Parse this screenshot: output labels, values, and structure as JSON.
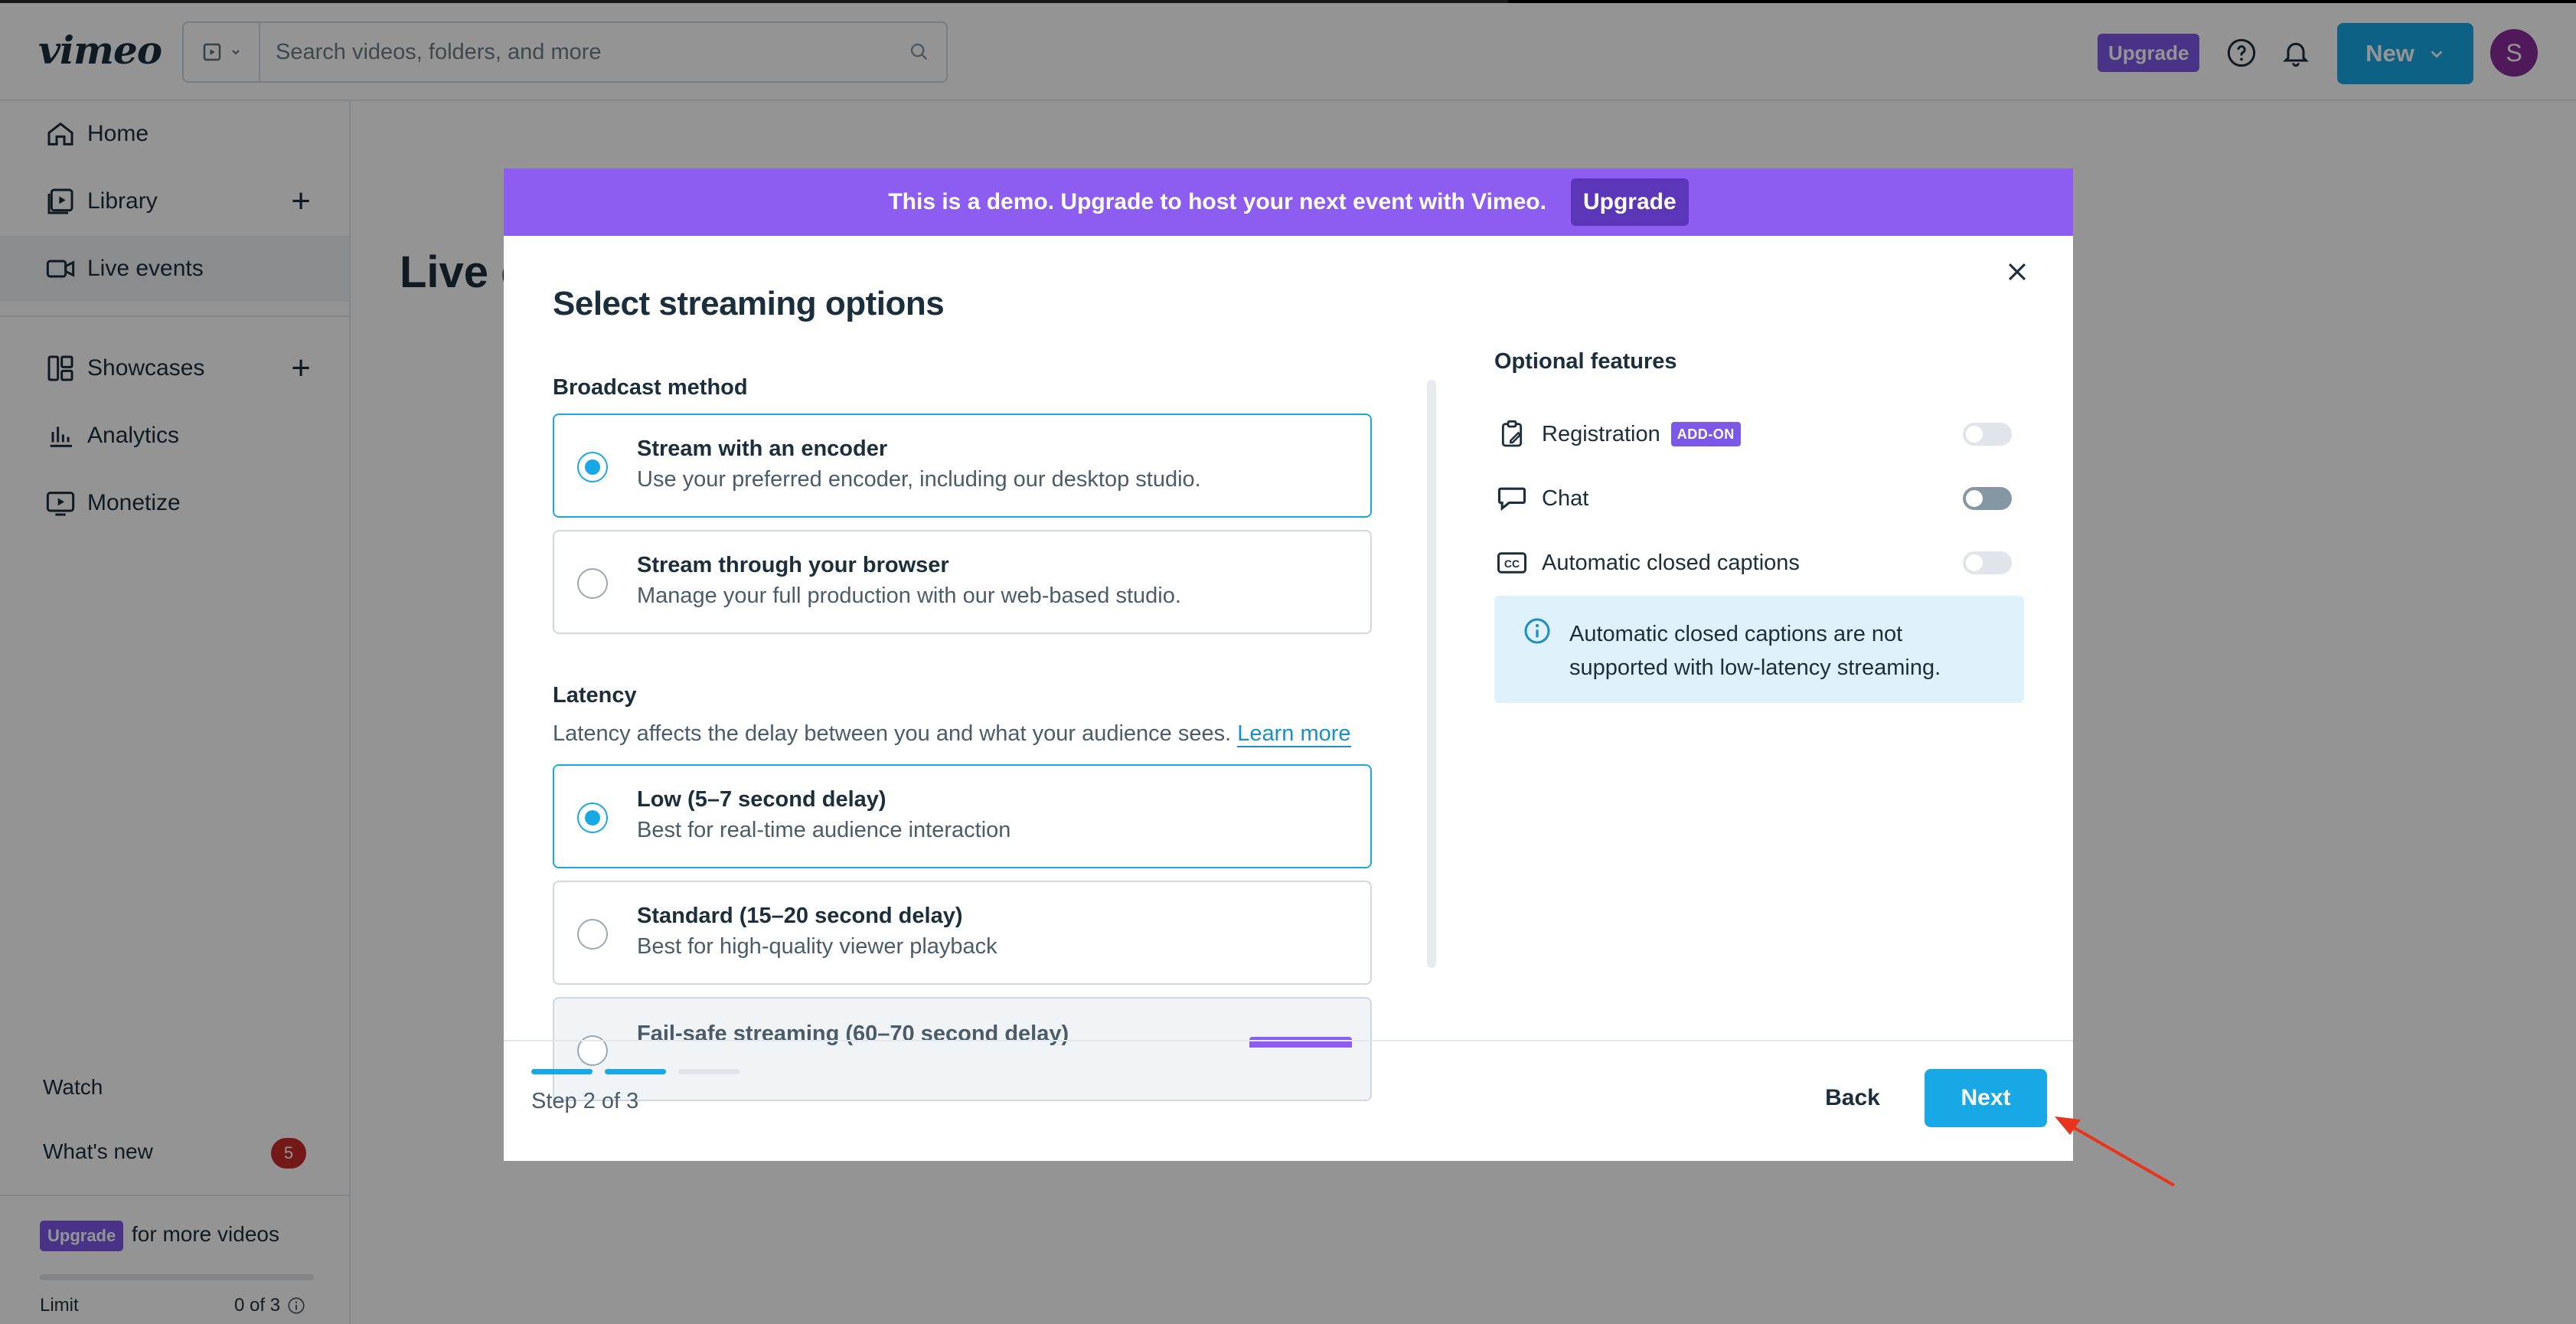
{
  "header": {
    "logo": "vimeo",
    "search_placeholder": "Search videos, folders, and more",
    "upgrade_label": "Upgrade",
    "new_label": "New",
    "avatar_initial": "S"
  },
  "sidebar": {
    "items": [
      {
        "label": "Home",
        "icon": "home-icon"
      },
      {
        "label": "Library",
        "icon": "library-icon"
      },
      {
        "label": "Live events",
        "icon": "camera-icon"
      },
      {
        "label": "Showcases",
        "icon": "showcases-icon"
      },
      {
        "label": "Analytics",
        "icon": "analytics-icon"
      },
      {
        "label": "Monetize",
        "icon": "monetize-icon"
      }
    ],
    "watch_label": "Watch",
    "whats_new_label": "What's new",
    "whats_new_count": "5",
    "upgrade_badge": "Upgrade",
    "upgrade_text": "for more videos",
    "limit_label": "Limit",
    "limit_value": "0 of 3"
  },
  "page": {
    "title": "Live events"
  },
  "modal": {
    "banner_text": "This is a demo. Upgrade to host your next event with Vimeo.",
    "banner_button": "Upgrade",
    "title": "Select streaming options",
    "broadcast_label": "Broadcast method",
    "broadcast_options": [
      {
        "title": "Stream with an encoder",
        "desc": "Use your preferred encoder, including our desktop studio.",
        "selected": true
      },
      {
        "title": "Stream through your browser",
        "desc": "Manage your full production with our web-based studio.",
        "selected": false
      }
    ],
    "latency_label": "Latency",
    "latency_desc": "Latency affects the delay between you and what your audience sees.",
    "learn_more": "Learn more",
    "latency_options": [
      {
        "title": "Low (5–7 second delay)",
        "desc": "Best for real-time audience interaction",
        "selected": true
      },
      {
        "title": "Standard (15–20 second delay)",
        "desc": "Best for high-quality viewer playback",
        "selected": false
      },
      {
        "title": "Fail-safe streaming (60–70 second delay)",
        "desc": "",
        "selected": false,
        "disabled": true
      }
    ],
    "optional_label": "Optional features",
    "features": [
      {
        "label": "Registration",
        "badge": "ADD-ON",
        "icon": "clipboard-icon",
        "enabled": false
      },
      {
        "label": "Chat",
        "badge": "",
        "icon": "chat-bubble-icon",
        "enabled": false
      },
      {
        "label": "Automatic closed captions",
        "badge": "",
        "icon": "cc-icon",
        "enabled": false
      }
    ],
    "info_text": "Automatic closed captions are not supported with low-latency streaming.",
    "step_label": "Step 2 of 3",
    "step_current": 2,
    "step_total": 3,
    "back_label": "Back",
    "next_label": "Next"
  },
  "colors": {
    "accent": "#17a8e5",
    "purple": "#8c5df0",
    "badge_red": "#c92a2a",
    "annotation_arrow": "#e8341c"
  }
}
